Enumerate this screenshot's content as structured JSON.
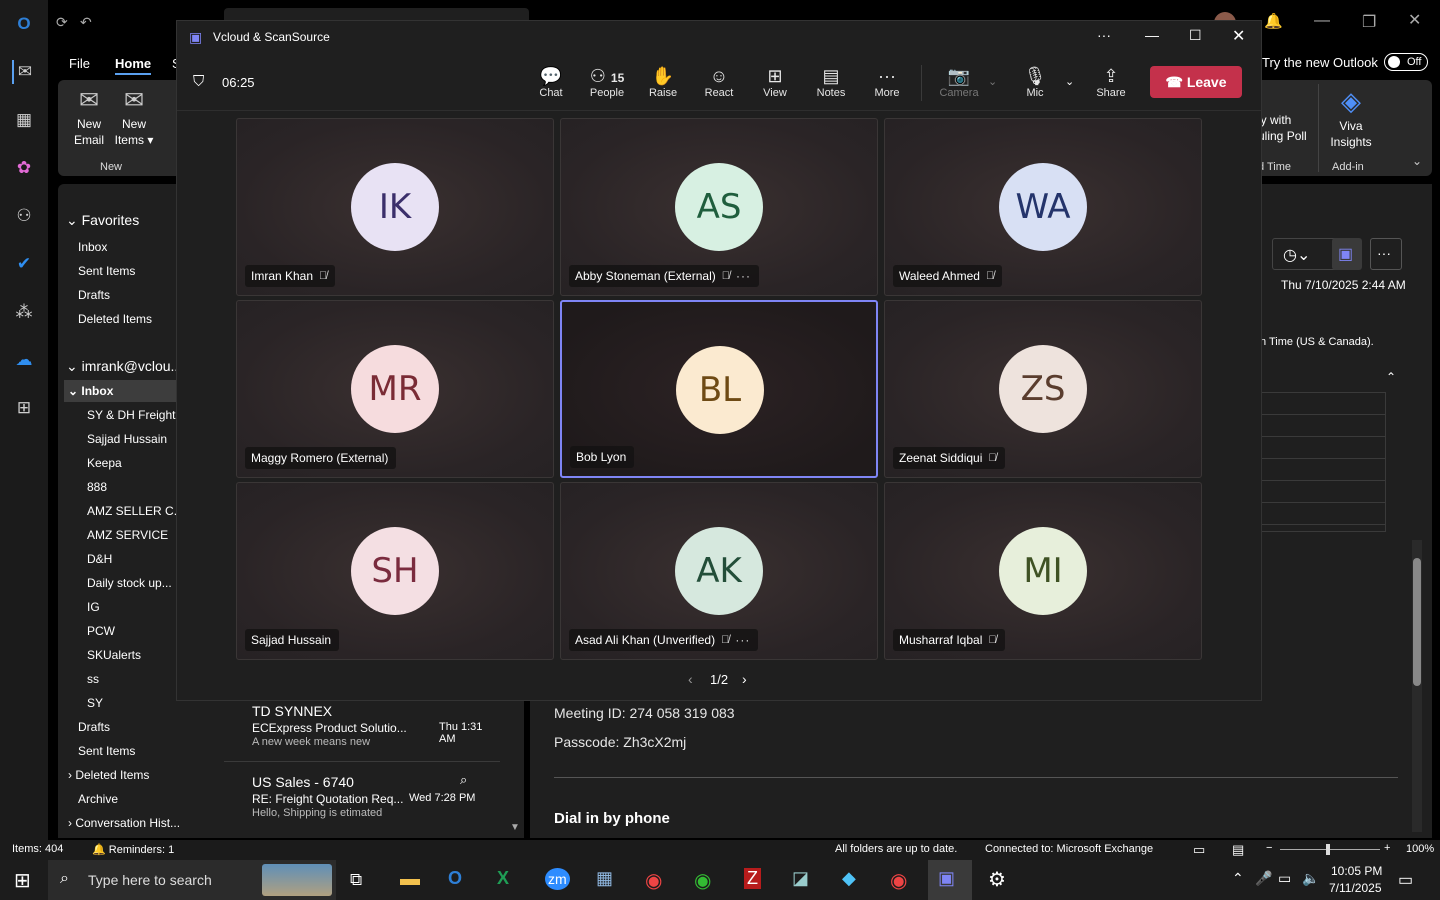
{
  "outlook": {
    "ribbon_tabs": [
      "File",
      "Home",
      "S"
    ],
    "try_new_outlook": "Try the new Outlook",
    "toggle_state": "Off",
    "new_email": [
      "New",
      "Email"
    ],
    "new_items": [
      "New",
      "Items ▾"
    ],
    "group_new": "New",
    "poll_lines": [
      "ly with",
      "uling Poll"
    ],
    "poll_group": "d Time",
    "viva": [
      "Viva",
      "Insights"
    ],
    "addin_group": "Add-in",
    "nav": {
      "favorites": "Favorites",
      "fav_items": [
        "Inbox",
        "Sent Items",
        "Drafts",
        "Deleted Items"
      ],
      "account": "imrank@vclou...",
      "inbox": "Inbox",
      "subfolders": [
        "SY & DH Freights",
        "Sajjad Hussain",
        "Keepa",
        "888",
        "AMZ SELLER C...",
        "AMZ SERVICE",
        "D&H",
        "Daily stock up...",
        "IG",
        "PCW",
        "SKUalerts",
        "ss",
        "SY"
      ],
      "after": [
        "Drafts",
        "Sent Items",
        "Deleted Items",
        "Archive",
        "Conversation Hist..."
      ]
    },
    "messages": [
      {
        "sender": "TD SYNNEX",
        "subject": "ECExpress Product Solutio...",
        "time": "Thu 1:31 AM",
        "preview": "A new week means new"
      },
      {
        "sender": "US Sales - 6740",
        "subject": "RE: Freight Quotation Req...",
        "time": "Wed 7:28 PM",
        "preview": "Hello, Shipping is etimated"
      }
    ],
    "reading": {
      "date": "Thu 7/10/2025 2:44 AM",
      "timezone": "n Time (US & Canada).",
      "meeting_id": "Meeting ID: 274 058 319 083",
      "passcode": "Passcode: Zh3cX2mj",
      "dial_in": "Dial in by phone"
    },
    "status": {
      "items": "Items: 404",
      "reminders": "Reminders: 1",
      "sync": "All folders are up to date.",
      "connected": "Connected to: Microsoft Exchange",
      "zoom": "100%"
    }
  },
  "teams": {
    "window_title": "Vcloud & ScanSource",
    "timer": "06:25",
    "people_count": "15",
    "buttons": [
      "Chat",
      "People",
      "Raise",
      "React",
      "View",
      "Notes",
      "More",
      "Camera",
      "Mic",
      "Share"
    ],
    "leave": "Leave",
    "page": "1/2",
    "participants": [
      {
        "initials": "IK",
        "name": "Imran Khan",
        "muted": true,
        "more": false,
        "bg": "#e8e2f4",
        "fg": "#3b2f6b"
      },
      {
        "initials": "AS",
        "name": "Abby Stoneman (External)",
        "muted": true,
        "more": true,
        "bg": "#d7f0e2",
        "fg": "#1f5e3d"
      },
      {
        "initials": "WA",
        "name": "Waleed Ahmed",
        "muted": true,
        "more": false,
        "bg": "#d8e0f4",
        "fg": "#24346b"
      },
      {
        "initials": "MR",
        "name": "Maggy Romero (External)",
        "muted": false,
        "more": false,
        "bg": "#f6dcde",
        "fg": "#7a2b35"
      },
      {
        "initials": "BL",
        "name": "Bob Lyon",
        "muted": false,
        "more": false,
        "bg": "#fbead0",
        "fg": "#6e4a14"
      },
      {
        "initials": "ZS",
        "name": "Zeenat Siddiqui",
        "muted": true,
        "more": false,
        "bg": "#eee3dd",
        "fg": "#5a3d2e"
      },
      {
        "initials": "SH",
        "name": "Sajjad Hussain",
        "muted": false,
        "more": false,
        "bg": "#f4dfe3",
        "fg": "#7a2b3e"
      },
      {
        "initials": "AK",
        "name": "Asad Ali Khan (Unverified)",
        "muted": true,
        "more": true,
        "bg": "#d6e8de",
        "fg": "#234e39"
      },
      {
        "initials": "MI",
        "name": "Musharraf Iqbal",
        "muted": true,
        "more": false,
        "bg": "#e7efdb",
        "fg": "#3f5224"
      }
    ]
  },
  "taskbar": {
    "search_placeholder": "Type here to search",
    "time": "10:05 PM",
    "date": "7/11/2025"
  }
}
